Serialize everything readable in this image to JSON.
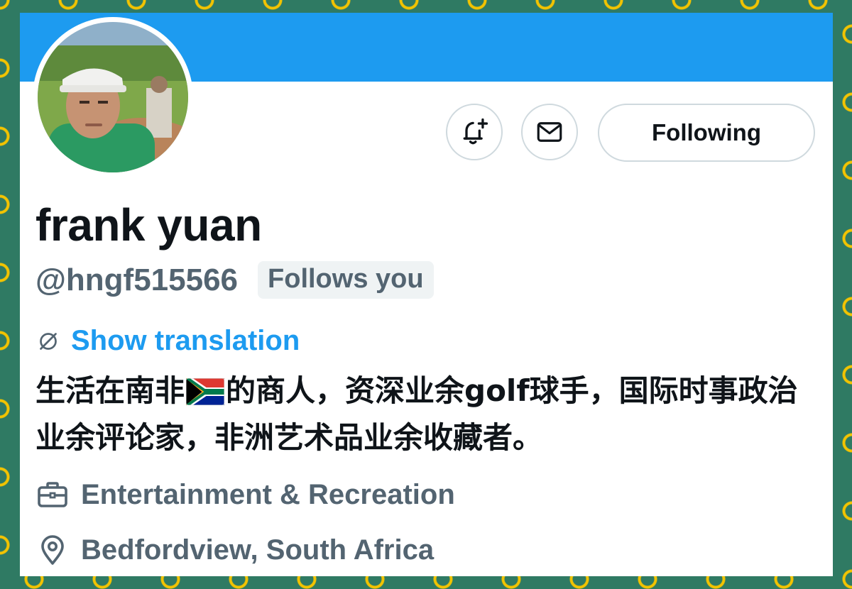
{
  "profile": {
    "display_name": "frank yuan",
    "handle": "@hngf515566",
    "follows_you": "Follows you",
    "show_translation": "Show translation",
    "bio_part1": "生活在南非",
    "bio_part2": "的商人，资深业余golf球手，国际时事政治业余评论家，非洲艺术品业余收藏者。",
    "category": "Entertainment & Recreation",
    "location": "Bedfordview, South Africa"
  },
  "actions": {
    "following_label": "Following"
  },
  "icons": {
    "notify": "bell-plus-icon",
    "message": "envelope-icon",
    "translate": "globe-slash-icon",
    "category": "briefcase-icon",
    "location": "map-pin-icon",
    "flag": "south-africa-flag-icon"
  },
  "colors": {
    "banner": "#1d9bf0",
    "link": "#1d9bf0",
    "text_primary": "#0f1419",
    "text_secondary": "#536471",
    "border": "#cfd9de",
    "frame_green": "#2f7a63",
    "frame_gold": "#f2c300"
  }
}
